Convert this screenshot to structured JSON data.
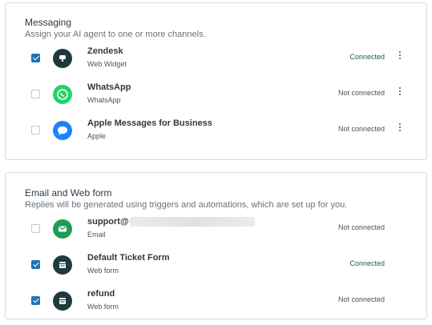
{
  "messaging": {
    "title": "Messaging",
    "subtitle": "Assign your AI agent to one or more channels.",
    "channels": [
      {
        "name": "Zendesk",
        "type": "Web Widget",
        "status": "Connected",
        "checked": true,
        "icon": "zendesk-widget-icon",
        "icon_color": "#1f3a3d"
      },
      {
        "name": "WhatsApp",
        "type": "WhatsApp",
        "status": "Not connected",
        "checked": false,
        "icon": "whatsapp-icon",
        "icon_color": "#25d366"
      },
      {
        "name": "Apple Messages for Business",
        "type": "Apple",
        "status": "Not connected",
        "checked": false,
        "icon": "apple-messages-icon",
        "icon_color": "#1a82fb"
      }
    ]
  },
  "email_web": {
    "title": "Email and Web form",
    "subtitle": "Replies will be generated using triggers and automations, which are set up for you.",
    "channels": [
      {
        "name": "support@",
        "type": "Email",
        "status": "Not connected",
        "checked": false,
        "icon": "email-icon",
        "icon_color": "#1f9d55"
      },
      {
        "name": "Default Ticket Form",
        "type": "Web form",
        "status": "Connected",
        "checked": true,
        "icon": "web-form-icon",
        "icon_color": "#1f3a3d"
      },
      {
        "name": "refund",
        "type": "Web form",
        "status": "Not connected",
        "checked": true,
        "icon": "web-form-icon",
        "icon_color": "#1f3a3d"
      }
    ]
  }
}
